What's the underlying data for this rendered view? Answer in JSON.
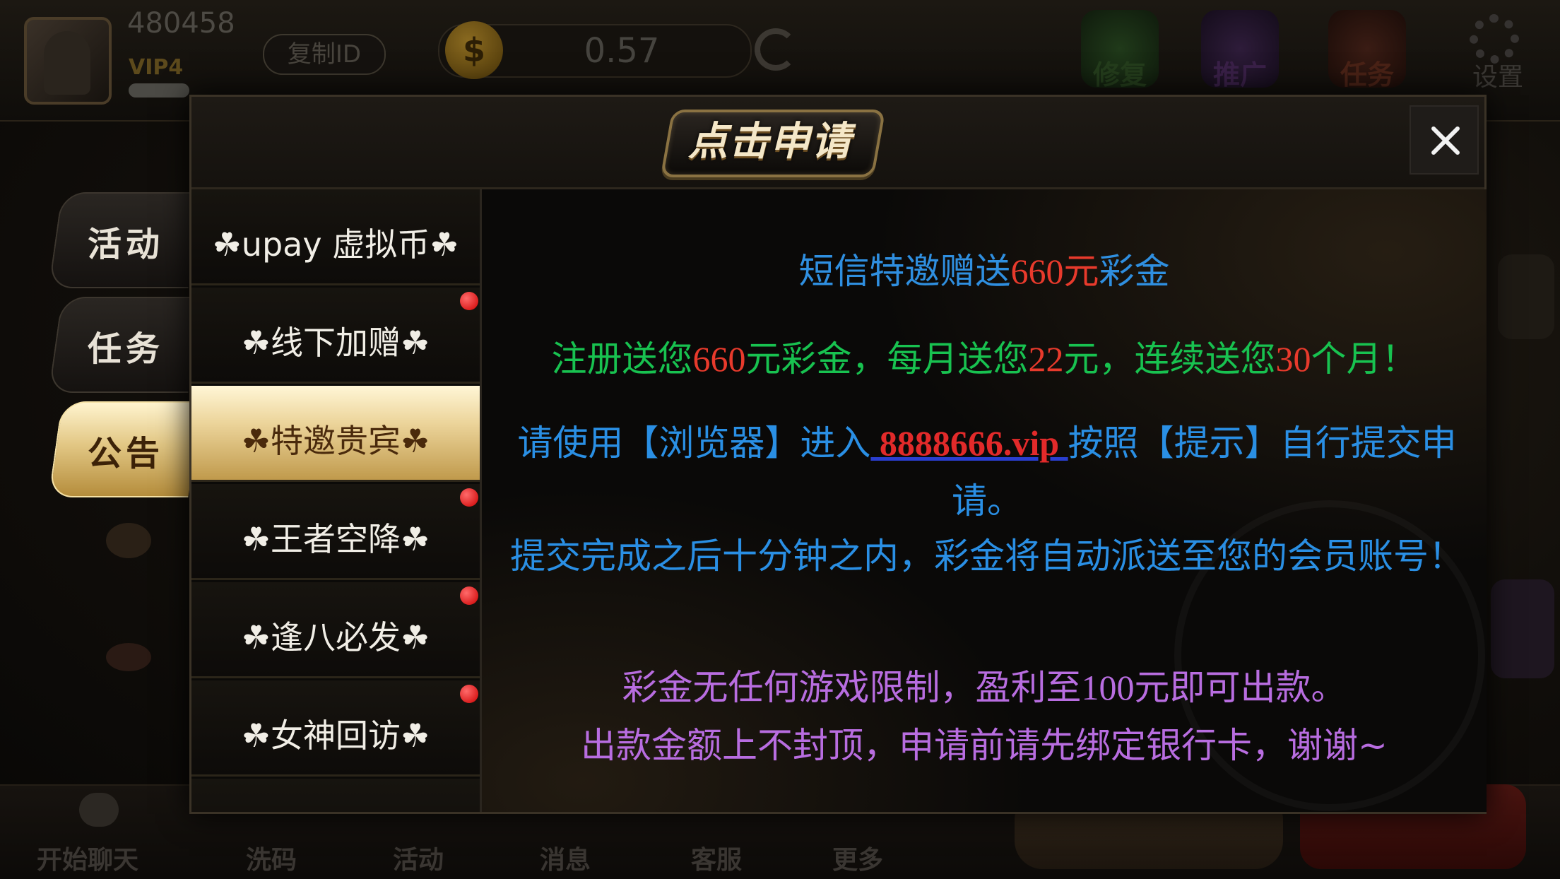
{
  "lobby": {
    "user_id": "480458",
    "vip_level": "VIP4",
    "copy_id_label": "复制ID",
    "balance": "0.57",
    "top_icons": [
      {
        "label": "修复",
        "icon": "wrench-icon"
      },
      {
        "label": "推广",
        "icon": "promo-icon"
      },
      {
        "label": "任务",
        "icon": "task-icon"
      }
    ],
    "settings_label": "设置",
    "bottom_nav": [
      "开始聊天",
      "洗码",
      "活动",
      "消息",
      "客服",
      "更多"
    ]
  },
  "modal": {
    "title": "点击申请",
    "side_tabs": [
      {
        "label": "活动",
        "active": false
      },
      {
        "label": "任务",
        "active": false
      },
      {
        "label": "公告",
        "active": true
      }
    ],
    "list_items": [
      {
        "label": "☘upay 虚拟币☘",
        "badge": false,
        "selected": false
      },
      {
        "label": "☘线下加赠☘",
        "badge": true,
        "selected": false
      },
      {
        "label": "☘特邀贵宾☘",
        "badge": false,
        "selected": true
      },
      {
        "label": "☘王者空降☘",
        "badge": true,
        "selected": false
      },
      {
        "label": "☘逢八必发☘",
        "badge": true,
        "selected": false
      },
      {
        "label": "☘女神回访☘",
        "badge": true,
        "selected": false
      }
    ],
    "content": {
      "heading_pre": "短信特邀赠送",
      "heading_amount": "660元",
      "heading_post": "彩金",
      "line2_a": "注册送您",
      "line2_b": "660",
      "line2_c": "元彩金，每月送您",
      "line2_d": "22",
      "line2_e": "元，连续送您",
      "line2_f": "30",
      "line2_g": "个月！",
      "para1_a": "请使用【浏览器】进入",
      "para1_link": " 8888666.vip ",
      "para1_b": "按照【提示】自行提交申请。",
      "para2": "提交完成之后十分钟之内，彩金将自动派送至您的会员账号！",
      "para3_a": "彩金无任何游戏限制，盈利至",
      "para3_num": "100",
      "para3_b": "元即可出款。",
      "para3_line2": "出款金额上不封顶，申请前请先绑定银行卡，谢谢~"
    }
  },
  "colors": {
    "heading_blue": "#2f8fe0",
    "highlight_red": "#e83a2c",
    "promo_green": "#18c250",
    "note_purple": "#b86de0",
    "gold": "#c09a4c"
  }
}
